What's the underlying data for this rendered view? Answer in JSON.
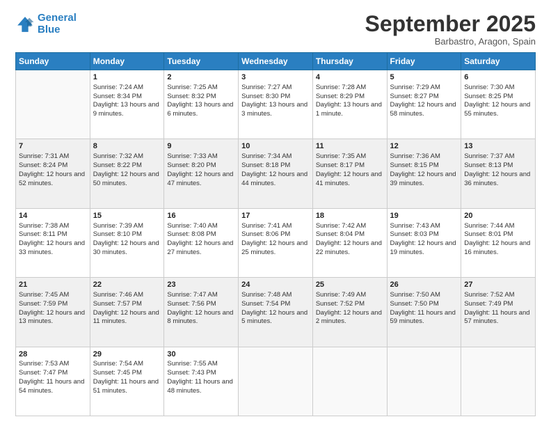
{
  "logo": {
    "line1": "General",
    "line2": "Blue"
  },
  "title": "September 2025",
  "location": "Barbastro, Aragon, Spain",
  "days_of_week": [
    "Sunday",
    "Monday",
    "Tuesday",
    "Wednesday",
    "Thursday",
    "Friday",
    "Saturday"
  ],
  "weeks": [
    [
      {
        "day": "",
        "empty": true
      },
      {
        "day": "1",
        "sunrise": "Sunrise: 7:24 AM",
        "sunset": "Sunset: 8:34 PM",
        "daylight": "Daylight: 13 hours and 9 minutes."
      },
      {
        "day": "2",
        "sunrise": "Sunrise: 7:25 AM",
        "sunset": "Sunset: 8:32 PM",
        "daylight": "Daylight: 13 hours and 6 minutes."
      },
      {
        "day": "3",
        "sunrise": "Sunrise: 7:27 AM",
        "sunset": "Sunset: 8:30 PM",
        "daylight": "Daylight: 13 hours and 3 minutes."
      },
      {
        "day": "4",
        "sunrise": "Sunrise: 7:28 AM",
        "sunset": "Sunset: 8:29 PM",
        "daylight": "Daylight: 13 hours and 1 minute."
      },
      {
        "day": "5",
        "sunrise": "Sunrise: 7:29 AM",
        "sunset": "Sunset: 8:27 PM",
        "daylight": "Daylight: 12 hours and 58 minutes."
      },
      {
        "day": "6",
        "sunrise": "Sunrise: 7:30 AM",
        "sunset": "Sunset: 8:25 PM",
        "daylight": "Daylight: 12 hours and 55 minutes."
      }
    ],
    [
      {
        "day": "7",
        "sunrise": "Sunrise: 7:31 AM",
        "sunset": "Sunset: 8:24 PM",
        "daylight": "Daylight: 12 hours and 52 minutes."
      },
      {
        "day": "8",
        "sunrise": "Sunrise: 7:32 AM",
        "sunset": "Sunset: 8:22 PM",
        "daylight": "Daylight: 12 hours and 50 minutes."
      },
      {
        "day": "9",
        "sunrise": "Sunrise: 7:33 AM",
        "sunset": "Sunset: 8:20 PM",
        "daylight": "Daylight: 12 hours and 47 minutes."
      },
      {
        "day": "10",
        "sunrise": "Sunrise: 7:34 AM",
        "sunset": "Sunset: 8:18 PM",
        "daylight": "Daylight: 12 hours and 44 minutes."
      },
      {
        "day": "11",
        "sunrise": "Sunrise: 7:35 AM",
        "sunset": "Sunset: 8:17 PM",
        "daylight": "Daylight: 12 hours and 41 minutes."
      },
      {
        "day": "12",
        "sunrise": "Sunrise: 7:36 AM",
        "sunset": "Sunset: 8:15 PM",
        "daylight": "Daylight: 12 hours and 39 minutes."
      },
      {
        "day": "13",
        "sunrise": "Sunrise: 7:37 AM",
        "sunset": "Sunset: 8:13 PM",
        "daylight": "Daylight: 12 hours and 36 minutes."
      }
    ],
    [
      {
        "day": "14",
        "sunrise": "Sunrise: 7:38 AM",
        "sunset": "Sunset: 8:11 PM",
        "daylight": "Daylight: 12 hours and 33 minutes."
      },
      {
        "day": "15",
        "sunrise": "Sunrise: 7:39 AM",
        "sunset": "Sunset: 8:10 PM",
        "daylight": "Daylight: 12 hours and 30 minutes."
      },
      {
        "day": "16",
        "sunrise": "Sunrise: 7:40 AM",
        "sunset": "Sunset: 8:08 PM",
        "daylight": "Daylight: 12 hours and 27 minutes."
      },
      {
        "day": "17",
        "sunrise": "Sunrise: 7:41 AM",
        "sunset": "Sunset: 8:06 PM",
        "daylight": "Daylight: 12 hours and 25 minutes."
      },
      {
        "day": "18",
        "sunrise": "Sunrise: 7:42 AM",
        "sunset": "Sunset: 8:04 PM",
        "daylight": "Daylight: 12 hours and 22 minutes."
      },
      {
        "day": "19",
        "sunrise": "Sunrise: 7:43 AM",
        "sunset": "Sunset: 8:03 PM",
        "daylight": "Daylight: 12 hours and 19 minutes."
      },
      {
        "day": "20",
        "sunrise": "Sunrise: 7:44 AM",
        "sunset": "Sunset: 8:01 PM",
        "daylight": "Daylight: 12 hours and 16 minutes."
      }
    ],
    [
      {
        "day": "21",
        "sunrise": "Sunrise: 7:45 AM",
        "sunset": "Sunset: 7:59 PM",
        "daylight": "Daylight: 12 hours and 13 minutes."
      },
      {
        "day": "22",
        "sunrise": "Sunrise: 7:46 AM",
        "sunset": "Sunset: 7:57 PM",
        "daylight": "Daylight: 12 hours and 11 minutes."
      },
      {
        "day": "23",
        "sunrise": "Sunrise: 7:47 AM",
        "sunset": "Sunset: 7:56 PM",
        "daylight": "Daylight: 12 hours and 8 minutes."
      },
      {
        "day": "24",
        "sunrise": "Sunrise: 7:48 AM",
        "sunset": "Sunset: 7:54 PM",
        "daylight": "Daylight: 12 hours and 5 minutes."
      },
      {
        "day": "25",
        "sunrise": "Sunrise: 7:49 AM",
        "sunset": "Sunset: 7:52 PM",
        "daylight": "Daylight: 12 hours and 2 minutes."
      },
      {
        "day": "26",
        "sunrise": "Sunrise: 7:50 AM",
        "sunset": "Sunset: 7:50 PM",
        "daylight": "Daylight: 11 hours and 59 minutes."
      },
      {
        "day": "27",
        "sunrise": "Sunrise: 7:52 AM",
        "sunset": "Sunset: 7:49 PM",
        "daylight": "Daylight: 11 hours and 57 minutes."
      }
    ],
    [
      {
        "day": "28",
        "sunrise": "Sunrise: 7:53 AM",
        "sunset": "Sunset: 7:47 PM",
        "daylight": "Daylight: 11 hours and 54 minutes."
      },
      {
        "day": "29",
        "sunrise": "Sunrise: 7:54 AM",
        "sunset": "Sunset: 7:45 PM",
        "daylight": "Daylight: 11 hours and 51 minutes."
      },
      {
        "day": "30",
        "sunrise": "Sunrise: 7:55 AM",
        "sunset": "Sunset: 7:43 PM",
        "daylight": "Daylight: 11 hours and 48 minutes."
      },
      {
        "day": "",
        "empty": true
      },
      {
        "day": "",
        "empty": true
      },
      {
        "day": "",
        "empty": true
      },
      {
        "day": "",
        "empty": true
      }
    ]
  ]
}
